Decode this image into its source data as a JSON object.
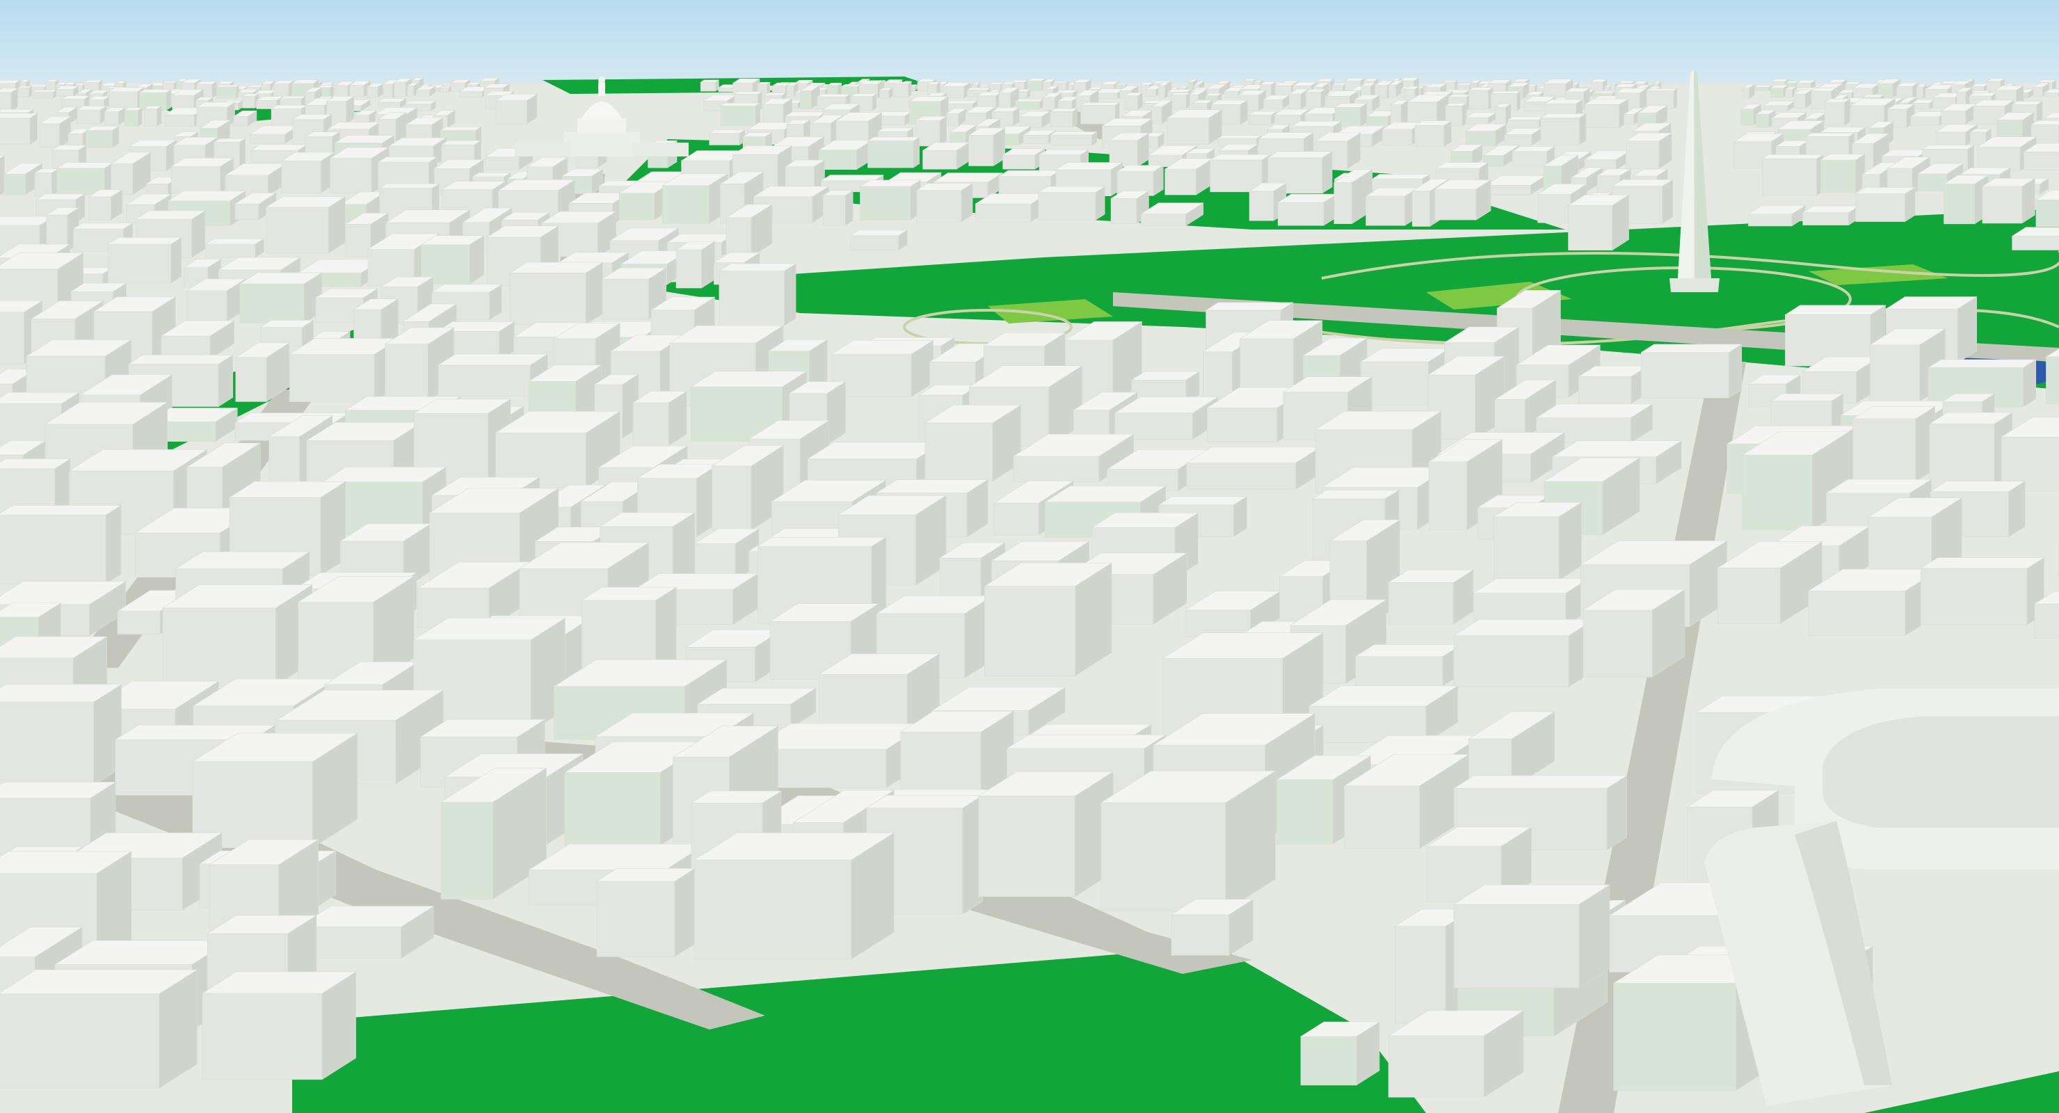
{
  "scene": {
    "type": "3d-city-map",
    "view": "oblique aerial",
    "colors": {
      "sky_top": "#b8dcef",
      "sky_bottom": "#f1f5f6",
      "ground": "#e6e8e2",
      "park": "#11a63a",
      "park_light": "#7fc843",
      "water": "#2b5aa8",
      "road": "#c5c6bb",
      "path": "#c9d3a6",
      "building_top": "#f4f5f2",
      "building_left": "#e3e6e0",
      "building_right": "#cfd4cc",
      "building_tint": "#d6e5d6"
    },
    "landmarks": [
      {
        "name": "obelisk-monument",
        "description_icon": "obelisk"
      },
      {
        "name": "capitol-dome",
        "description_icon": "dome"
      },
      {
        "name": "pond",
        "description_icon": "water"
      }
    ]
  }
}
